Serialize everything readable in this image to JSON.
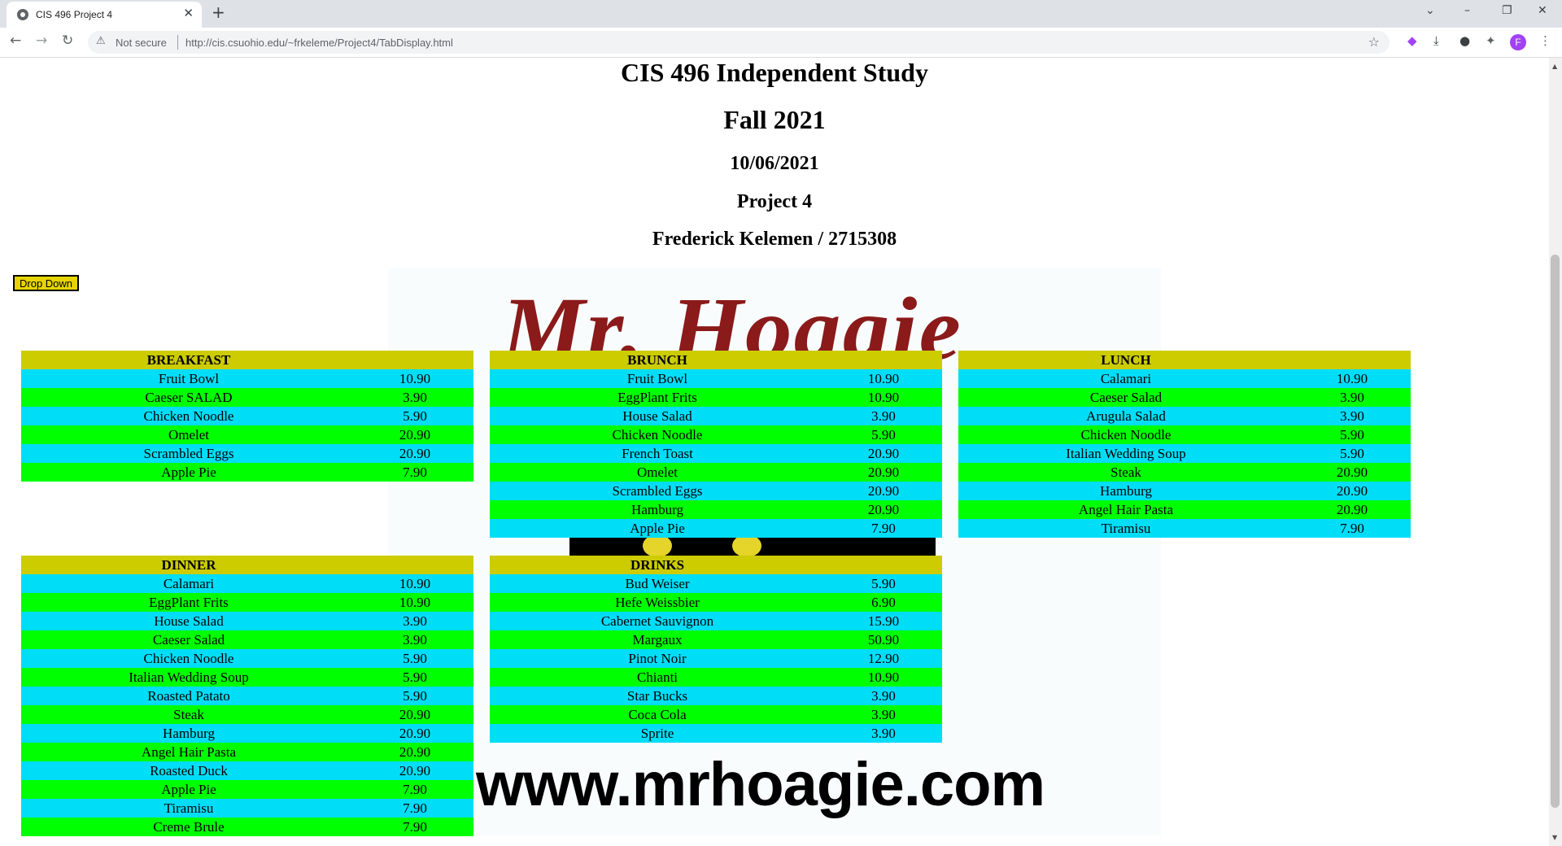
{
  "browser": {
    "tab_title": "CIS 496 Project 4",
    "close_glyph": "✕",
    "new_tab_glyph": "+",
    "security_label": "Not secure",
    "url": "http://cis.csuohio.edu/~frkeleme/Project4/TabDisplay.html",
    "profile_initial": "F"
  },
  "page": {
    "title": "CIS 496 Independent Study",
    "term": "Fall 2021",
    "date": "10/06/2021",
    "project": "Project 4",
    "author": "Frederick Kelemen / 2715308",
    "dropdown_label": "Drop Down",
    "logo_text": "Mr. Hoagie",
    "website": "www.mrhoagie.com"
  },
  "menus": [
    {
      "title": "BREAKFAST",
      "items": [
        {
          "name": "Fruit Bowl",
          "price": "10.90"
        },
        {
          "name": "Caeser SALAD",
          "price": "3.90"
        },
        {
          "name": "Chicken Noodle",
          "price": "5.90"
        },
        {
          "name": "Omelet",
          "price": "20.90"
        },
        {
          "name": "Scrambled Eggs",
          "price": "20.90"
        },
        {
          "name": "Apple Pie",
          "price": "7.90"
        }
      ]
    },
    {
      "title": "BRUNCH",
      "items": [
        {
          "name": "Fruit Bowl",
          "price": "10.90"
        },
        {
          "name": "EggPlant Frits",
          "price": "10.90"
        },
        {
          "name": "House Salad",
          "price": "3.90"
        },
        {
          "name": "Chicken Noodle",
          "price": "5.90"
        },
        {
          "name": "French Toast",
          "price": "20.90"
        },
        {
          "name": "Omelet",
          "price": "20.90"
        },
        {
          "name": "Scrambled Eggs",
          "price": "20.90"
        },
        {
          "name": "Hamburg",
          "price": "20.90"
        },
        {
          "name": "Apple Pie",
          "price": "7.90"
        }
      ]
    },
    {
      "title": "LUNCH",
      "items": [
        {
          "name": "Calamari",
          "price": "10.90"
        },
        {
          "name": "Caeser Salad",
          "price": "3.90"
        },
        {
          "name": "Arugula Salad",
          "price": "3.90"
        },
        {
          "name": "Chicken Noodle",
          "price": "5.90"
        },
        {
          "name": "Italian Wedding Soup",
          "price": "5.90"
        },
        {
          "name": "Steak",
          "price": "20.90"
        },
        {
          "name": "Hamburg",
          "price": "20.90"
        },
        {
          "name": "Angel Hair Pasta",
          "price": "20.90"
        },
        {
          "name": "Tiramisu",
          "price": "7.90"
        }
      ]
    },
    {
      "title": "DINNER",
      "items": [
        {
          "name": "Calamari",
          "price": "10.90"
        },
        {
          "name": "EggPlant Frits",
          "price": "10.90"
        },
        {
          "name": "House Salad",
          "price": "3.90"
        },
        {
          "name": "Caeser Salad",
          "price": "3.90"
        },
        {
          "name": "Chicken Noodle",
          "price": "5.90"
        },
        {
          "name": "Italian Wedding Soup",
          "price": "5.90"
        },
        {
          "name": "Roasted Patato",
          "price": "5.90"
        },
        {
          "name": "Steak",
          "price": "20.90"
        },
        {
          "name": "Hamburg",
          "price": "20.90"
        },
        {
          "name": "Angel Hair Pasta",
          "price": "20.90"
        },
        {
          "name": "Roasted Duck",
          "price": "20.90"
        },
        {
          "name": "Apple Pie",
          "price": "7.90"
        },
        {
          "name": "Tiramisu",
          "price": "7.90"
        },
        {
          "name": "Creme Brule",
          "price": "7.90"
        }
      ]
    },
    {
      "title": "DRINKS",
      "items": [
        {
          "name": "Bud Weiser",
          "price": "5.90"
        },
        {
          "name": "Hefe Weissbier",
          "price": "6.90"
        },
        {
          "name": "Cabernet Sauvignon",
          "price": "15.90"
        },
        {
          "name": "Margaux",
          "price": "50.90"
        },
        {
          "name": "Pinot Noir",
          "price": "12.90"
        },
        {
          "name": "Chianti",
          "price": "10.90"
        },
        {
          "name": "Star Bucks",
          "price": "3.90"
        },
        {
          "name": "Coca Cola",
          "price": "3.90"
        },
        {
          "name": "Sprite",
          "price": "3.90"
        }
      ]
    }
  ],
  "colors": {
    "header": "#cccc00",
    "row_odd": "#00ddf7",
    "row_even": "#00ff00",
    "dropdown_bg": "#e6d400",
    "logo": "#8b1a1a"
  }
}
